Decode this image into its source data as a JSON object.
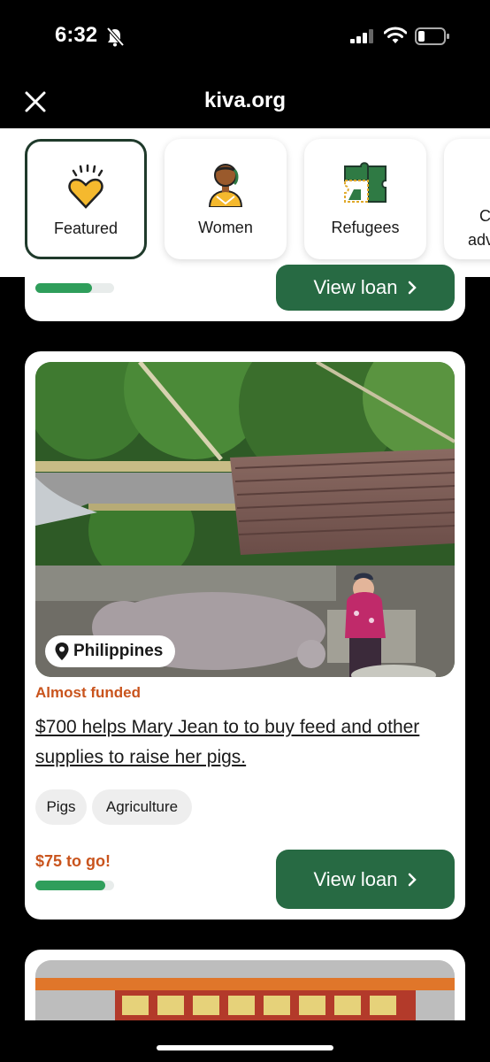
{
  "status_bar": {
    "time": "6:32"
  },
  "browser": {
    "domain": "kiva.org"
  },
  "categories": [
    {
      "label": "Featured",
      "icon": "heart-icon"
    },
    {
      "label": "Women",
      "icon": "woman-icon"
    },
    {
      "label": "Refugees",
      "icon": "puzzle-icon"
    },
    {
      "label_line1": "C",
      "label_line2": "adv"
    }
  ],
  "prev_card": {
    "button_label": "View loan",
    "progress": 0.72
  },
  "loan_card": {
    "location": "Philippines",
    "status": "Almost funded",
    "title": "$700 helps Mary Jean to to buy feed and other supplies to raise her pigs.",
    "tags": [
      "Pigs",
      "Agriculture"
    ],
    "remaining": "$75 to go!",
    "progress": 0.89,
    "button_label": "View loan"
  },
  "colors": {
    "brand_green": "#276a43",
    "progress_green": "#2f9e5b",
    "accent_orange": "#c9541d"
  }
}
